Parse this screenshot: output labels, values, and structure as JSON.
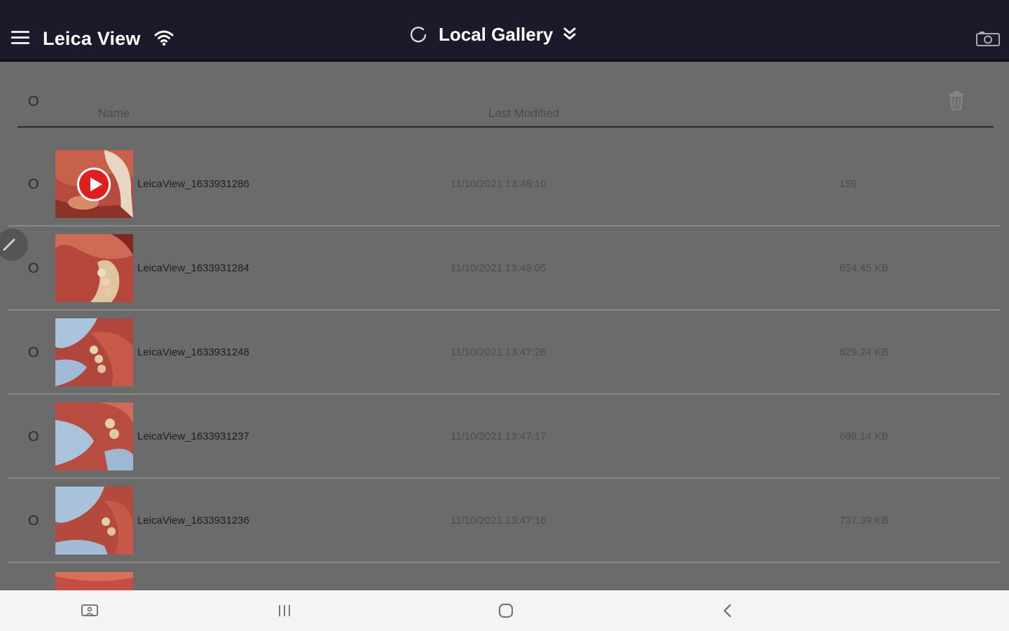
{
  "topbar": {
    "app_title": "Leica View",
    "gallery_title": "Local Gallery",
    "icons": [
      "menu-icon",
      "wifi-icon",
      "refresh-icon",
      "chevron-double-down-icon",
      "camera-switch-icon"
    ]
  },
  "header": {
    "select_all": "O",
    "col_name": "Name",
    "col_modified": "Last Modified",
    "delete_icon": "trash-icon"
  },
  "rows": [
    {
      "select": "O",
      "name": "LeicaView_1633931286",
      "modified": "11/10/2021 13:48:10",
      "size": "159",
      "is_video": true
    },
    {
      "select": "O",
      "name": "LeicaView_1633931284",
      "modified": "11/10/2021 13:48:05",
      "size": "854.45 KB",
      "is_video": false
    },
    {
      "select": "O",
      "name": "LeicaView_1633931248",
      "modified": "11/10/2021 13:47:28",
      "size": "829.24 KB",
      "is_video": false
    },
    {
      "select": "O",
      "name": "LeicaView_1633931237",
      "modified": "11/10/2021 13:47:17",
      "size": "688.14 KB",
      "is_video": false
    },
    {
      "select": "O",
      "name": "LeicaView_1633931236",
      "modified": "11/10/2021 13:47:16",
      "size": "737.39 KB",
      "is_video": false
    }
  ],
  "navbar": {
    "icons": [
      "screenshot-icon",
      "recents-icon",
      "home-icon",
      "back-icon"
    ]
  },
  "colors": {
    "topbar_bg": "#1b1a2a",
    "content_bg": "#6b6b6b",
    "play_red": "#e02020",
    "navbar_bg": "#f4f4f6"
  }
}
